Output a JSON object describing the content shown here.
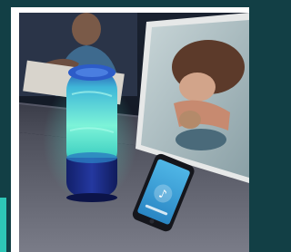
{
  "product": {
    "name": "speaker"
  },
  "colors": {
    "background": "#123f45",
    "accent_bar": "#2ec6b6",
    "frame": "#ffffff",
    "speaker_glow": "#58e6d2",
    "speaker_base": "#1a2a80",
    "carpet": "#6f7180"
  },
  "phone": {
    "screen_color": "#3da3d8",
    "app_glyph": "♪"
  }
}
